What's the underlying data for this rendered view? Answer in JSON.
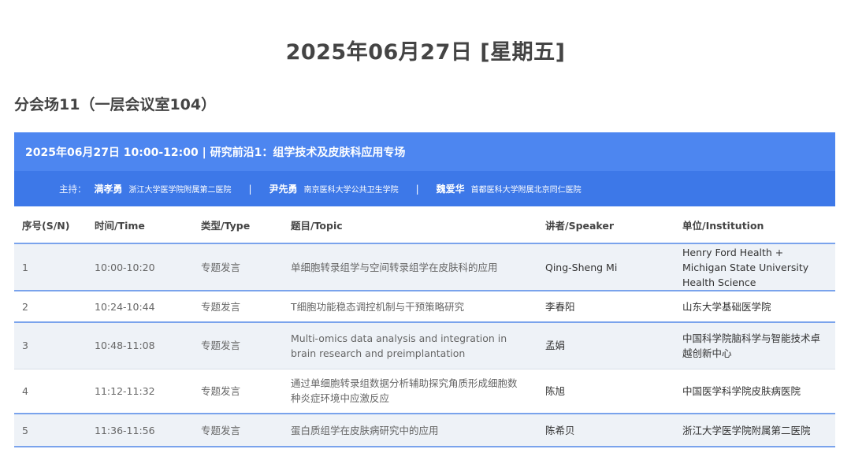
{
  "date_title": "2025年06月27日 [星期五]",
  "room_title": "分会场11（一层会议室104）",
  "session": {
    "header": "2025年06月27日 10:00-12:00 | 研究前沿1：组学技术及皮肤科应用专场",
    "hosts_label": "主持：",
    "separator": "|",
    "hosts": [
      {
        "name": "满孝勇",
        "institution": "浙江大学医学院附属第二医院"
      },
      {
        "name": "尹先勇",
        "institution": "南京医科大学公共卫生学院"
      },
      {
        "name": "魏爱华",
        "institution": "首都医科大学附属北京同仁医院"
      }
    ]
  },
  "table": {
    "columns": [
      "序号(S/N)",
      "时间/Time",
      "类型/Type",
      "题目/Topic",
      "讲者/Speaker",
      "单位/Institution"
    ],
    "rows": [
      {
        "sn": "1",
        "time": "10:00-10:20",
        "type": "专题发言",
        "topic": "单细胞转录组学与空间转录组学在皮肤科的应用",
        "speaker": "Qing-Sheng Mi",
        "institution": "Henry Ford Health + Michigan State University Health Science"
      },
      {
        "sn": "2",
        "time": "10:24-10:44",
        "type": "专题发言",
        "topic": "T细胞功能稳态调控机制与干预策略研究",
        "speaker": "李春阳",
        "institution": "山东大学基础医学院"
      },
      {
        "sn": "3",
        "time": "10:48-11:08",
        "type": "专题发言",
        "topic": "Multi-omics data analysis and integration in brain research and preimplantation",
        "speaker": "孟娟",
        "institution": "中国科学院脑科学与智能技术卓越创新中心"
      },
      {
        "sn": "4",
        "time": "11:12-11:32",
        "type": "专题发言",
        "topic": "通过单细胞转录组数据分析辅助探究角质形成细胞数种炎症环境中应激反应",
        "speaker": "陈旭",
        "institution": "中国医学科学院皮肤病医院"
      },
      {
        "sn": "5",
        "time": "11:36-11:56",
        "type": "专题发言",
        "topic": "蛋白质组学在皮肤病研究中的应用",
        "speaker": "陈希贝",
        "institution": "浙江大学医学院附属第二医院"
      }
    ]
  },
  "colors": {
    "header_blue": "#4d86f0",
    "hosts_blue": "#3d78e8",
    "row_shade": "#eef2f7",
    "row_border": "#7aa3ec"
  }
}
